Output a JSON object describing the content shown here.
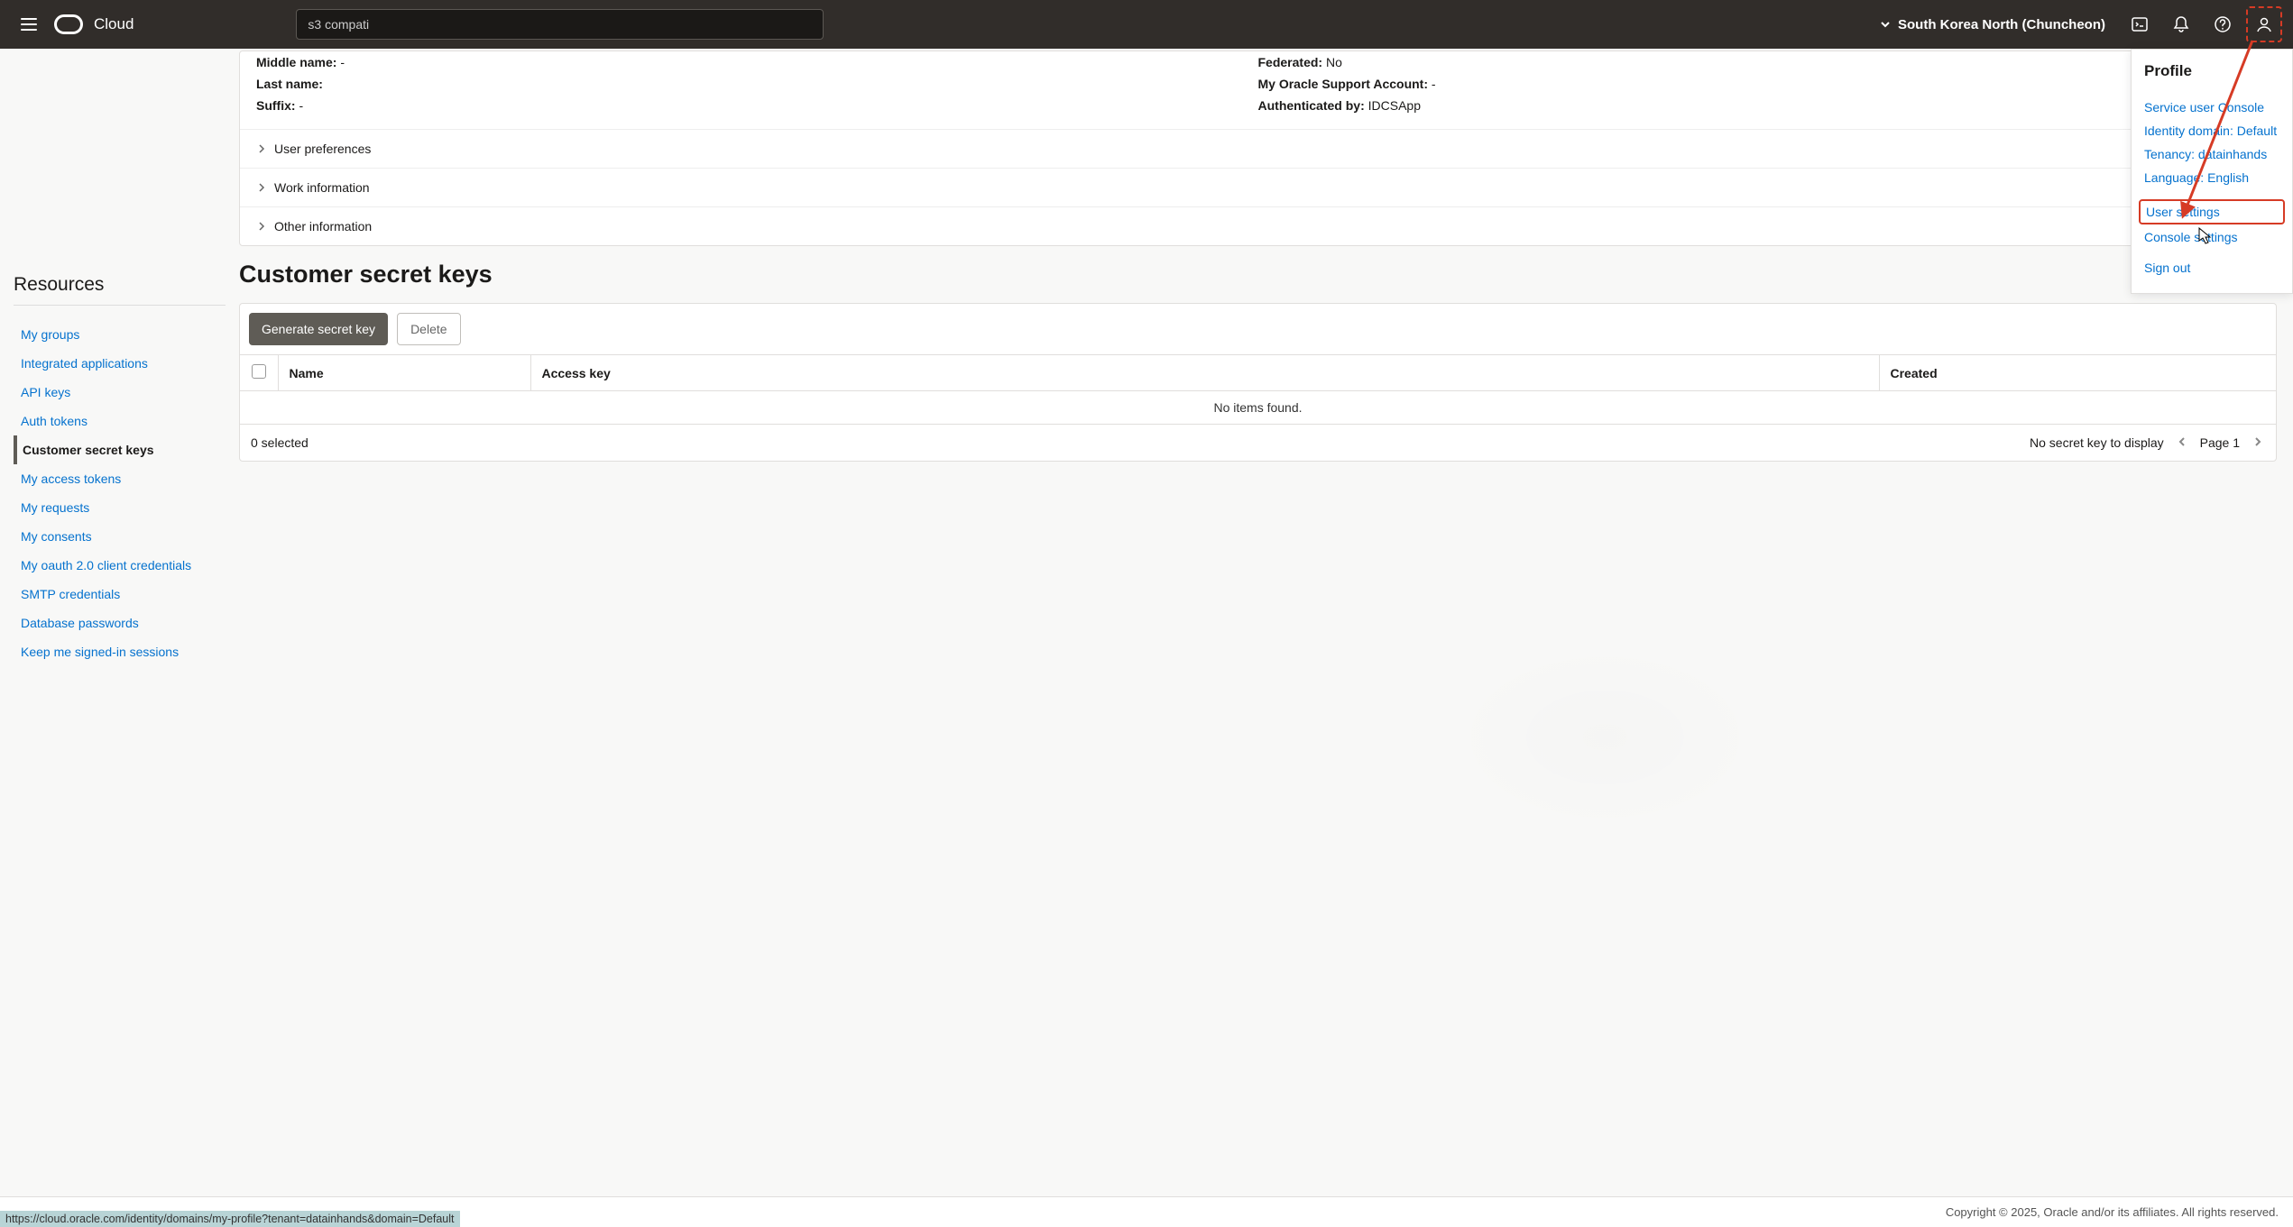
{
  "header": {
    "brand": "Cloud",
    "search_value": "s3 compati",
    "region": "South Korea North (Chuncheon)"
  },
  "user_info": {
    "middle_name_label": "Middle name:",
    "middle_name_value": " -",
    "last_name_label": "Last name:",
    "last_name_value": " ",
    "suffix_label": "Suffix:",
    "suffix_value": " -",
    "federated_label": "Federated:",
    "federated_value": " No",
    "support_label": "My Oracle Support Account:",
    "support_value": " -",
    "auth_label": "Authenticated by:",
    "auth_value": " IDCSApp"
  },
  "accordions": {
    "user_preferences": "User preferences",
    "work_information": "Work information",
    "other_information": "Other information"
  },
  "sidebar": {
    "title": "Resources",
    "items": [
      {
        "label": "My groups",
        "active": false
      },
      {
        "label": "Integrated applications",
        "active": false
      },
      {
        "label": "API keys",
        "active": false
      },
      {
        "label": "Auth tokens",
        "active": false
      },
      {
        "label": "Customer secret keys",
        "active": true
      },
      {
        "label": "My access tokens",
        "active": false
      },
      {
        "label": "My requests",
        "active": false
      },
      {
        "label": "My consents",
        "active": false
      },
      {
        "label": "My oauth 2.0 client credentials",
        "active": false
      },
      {
        "label": "SMTP credentials",
        "active": false
      },
      {
        "label": "Database passwords",
        "active": false
      },
      {
        "label": "Keep me signed-in sessions",
        "active": false
      }
    ]
  },
  "section": {
    "title": "Customer secret keys",
    "generate_btn": "Generate secret key",
    "delete_btn": "Delete"
  },
  "table": {
    "columns": {
      "name": "Name",
      "access_key": "Access key",
      "created": "Created"
    },
    "empty": "No items found.",
    "footer_selected": "0 selected",
    "footer_none": "No secret key to display",
    "footer_page": "Page 1"
  },
  "profile": {
    "title": "Profile",
    "service_user": "Service user Console",
    "identity_domain": "Identity domain: Default",
    "tenancy": "Tenancy: datainhands",
    "language": "Language: English",
    "user_settings": "User settings",
    "console_settings": "Console settings",
    "sign_out": "Sign out"
  },
  "footer": {
    "url": "https://cloud.oracle.com/identity/domains/my-profile?tenant=datainhands&domain=Default",
    "copyright": "Copyright © 2025, Oracle and/or its affiliates. All rights reserved."
  }
}
